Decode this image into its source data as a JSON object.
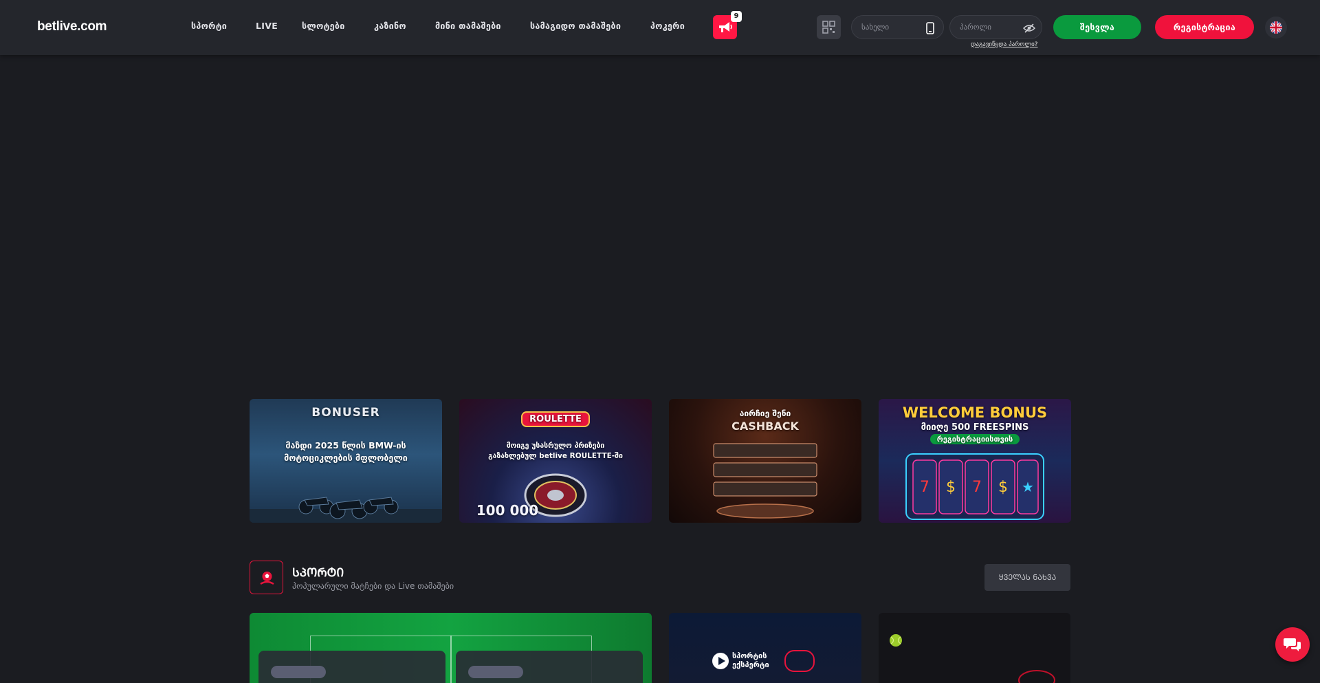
{
  "header": {
    "logo": "betlive.com",
    "nav": [
      {
        "label": "სპორტი"
      },
      {
        "label": "LIVE"
      },
      {
        "label": "სლოტები"
      },
      {
        "label": "კაზინო"
      },
      {
        "label": "მინი თამაშები"
      },
      {
        "label": "სამაგიდო თამაშები"
      },
      {
        "label": "პოკერი"
      }
    ],
    "promo_badge": "9",
    "username_placeholder": "სახელი",
    "password_placeholder": "პაროლი",
    "forgot_password": "დაგავიწყდა პაროლი?",
    "login_label": "შესვლა",
    "register_label": "რეგისტრაცია"
  },
  "banners": [
    {
      "title": "BONUSER",
      "line1": "მაზდი 2025 წლის BMW-ის",
      "line2": "მოტოციკლების მფლობელი"
    },
    {
      "title": "ROULETTE",
      "line1": "მოიგე უსასრულო პრიზები",
      "line2": "გაზახლებულ betlive ROULETTE-ში",
      "line3": "100 000"
    },
    {
      "title": "CASHBACK",
      "line1": "აირჩიე შენი",
      "line2": ""
    },
    {
      "title": "WELCOME BONUS",
      "line1": "მიიღე 500 FREESPINS",
      "line2": "რეგისტრაციისთვის"
    }
  ],
  "section": {
    "title": "ᲡᲞᲝᲠᲢᲘ",
    "subtitle": "პოპულარული მატჩები და Live თამაშები",
    "all_label": "ᲧᲕᲔᲚᲐᲡ ᲜᲐᲮᲕᲐ"
  },
  "cards": {
    "sport_line1": "სპორტის",
    "sport_line2": "ექსპერტი"
  },
  "colors": {
    "accent_red": "#f0123c",
    "login_green": "#0a9a3e",
    "header_bg": "#24262c",
    "page_bg": "#1b1c21"
  },
  "icons": [
    "megaphone-icon",
    "qr-code-icon",
    "phone-icon",
    "eye-slash-icon",
    "uk-flag-icon",
    "soccer-icon",
    "chat-icon"
  ]
}
